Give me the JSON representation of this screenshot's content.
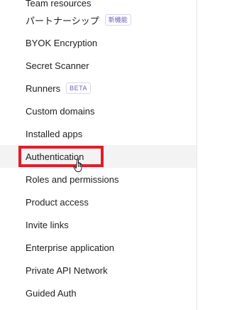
{
  "sidebar": {
    "items": [
      {
        "label": "Team resources",
        "badge": ""
      },
      {
        "label": "パートナーシップ",
        "badge": "新機能"
      },
      {
        "label": "BYOK Encryption",
        "badge": ""
      },
      {
        "label": "Secret Scanner",
        "badge": ""
      },
      {
        "label": "Runners",
        "badge": "BETA"
      },
      {
        "label": "Custom domains",
        "badge": ""
      },
      {
        "label": "Installed apps",
        "badge": ""
      },
      {
        "label": "Authentication",
        "badge": "",
        "active": true
      },
      {
        "label": "Roles and permissions",
        "badge": ""
      },
      {
        "label": "Product access",
        "badge": ""
      },
      {
        "label": "Invite links",
        "badge": ""
      },
      {
        "label": "Enterprise application",
        "badge": ""
      },
      {
        "label": "Private API Network",
        "badge": ""
      },
      {
        "label": "Guided Auth",
        "badge": ""
      }
    ]
  },
  "colors": {
    "highlight": "#e11d2a",
    "badge_text": "#6b5fb5",
    "active_bg": "#f3f3f3"
  },
  "icons": {
    "cursor": "hand-pointer-icon"
  }
}
